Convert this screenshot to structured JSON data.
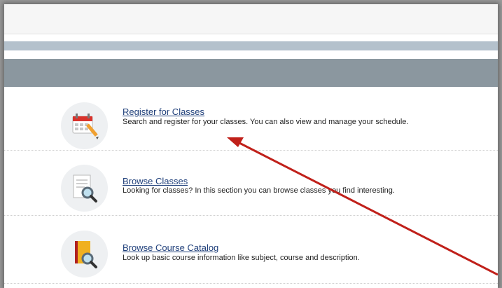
{
  "items": [
    {
      "title": "Register for Classes",
      "description": "Search and register for your classes. You can also view and manage your schedule."
    },
    {
      "title": "Browse Classes",
      "description": "Looking for classes? In this section you can browse classes you find interesting."
    },
    {
      "title": "Browse Course Catalog",
      "description": "Look up basic course information like subject, course and description."
    }
  ],
  "colors": {
    "link": "#1f3f7a",
    "header_band": "#8b979f",
    "stripe": "#b4c1cc",
    "annotation_arrow": "#c0201a"
  }
}
